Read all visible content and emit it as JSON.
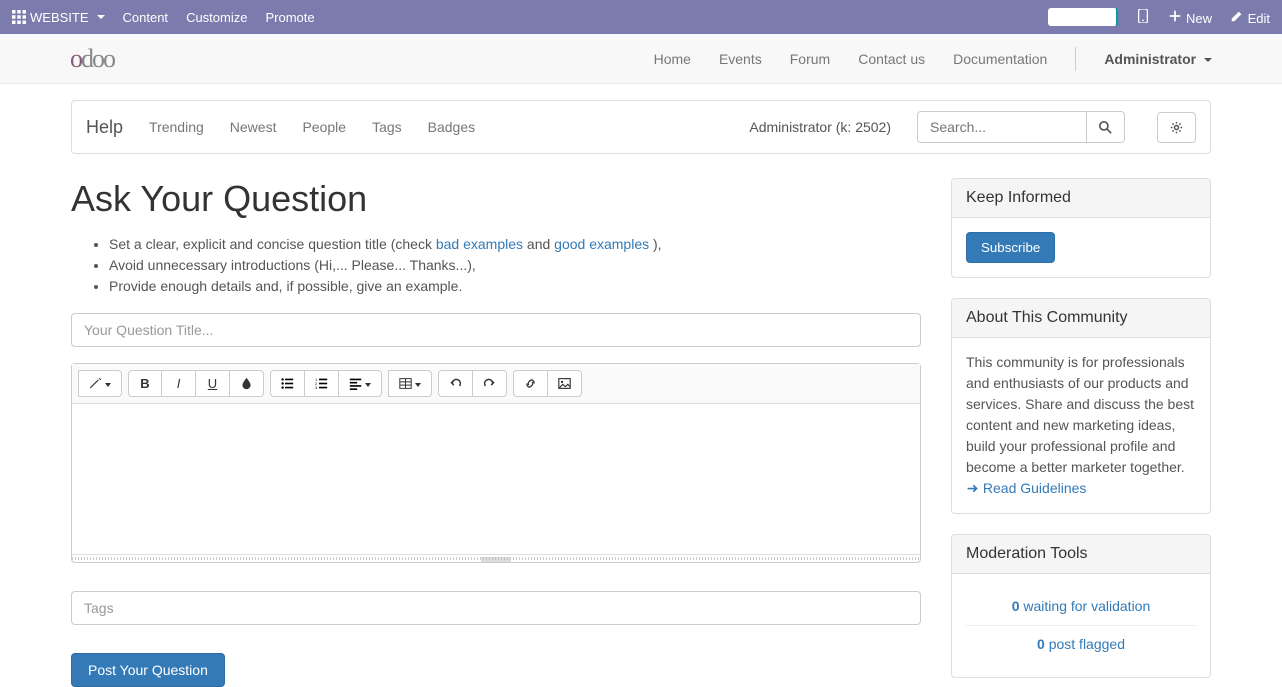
{
  "topbar": {
    "website_label": "WEBSITE",
    "content": "Content",
    "customize": "Customize",
    "promote": "Promote",
    "new": "New",
    "edit": "Edit"
  },
  "navbar": {
    "logo": "odoo",
    "links": [
      "Home",
      "Events",
      "Forum",
      "Contact us",
      "Documentation"
    ],
    "admin": "Administrator"
  },
  "forumbar": {
    "help": "Help",
    "tabs": [
      "Trending",
      "Newest",
      "People",
      "Tags",
      "Badges"
    ],
    "karma": "Administrator (k: 2502)",
    "search_placeholder": "Search..."
  },
  "page": {
    "title": "Ask Your Question",
    "guide1_a": "Set a clear, explicit and concise question title (check ",
    "guide1_link1": "bad examples",
    "guide1_mid": " and ",
    "guide1_link2": "good examples",
    "guide1_end": " ),",
    "guide2": "Avoid unnecessary introductions (Hi,... Please... Thanks...),",
    "guide3": "Provide enough details and, if possible, give an example.",
    "title_placeholder": "Your Question Title...",
    "tags_placeholder": "Tags",
    "post_btn": "Post Your Question"
  },
  "sidebar": {
    "keep_informed": "Keep Informed",
    "subscribe": "Subscribe",
    "about_title": "About This Community",
    "about_text": "This community is for professionals and enthusiasts of our products and services. Share and discuss the best content and new marketing ideas, build your professional profile and become a better marketer together.",
    "read_guidelines": "Read Guidelines",
    "mod_title": "Moderation Tools",
    "mod_validation_count": "0",
    "mod_validation_text": " waiting for validation",
    "mod_flagged_count": "0",
    "mod_flagged_text": " post flagged"
  }
}
